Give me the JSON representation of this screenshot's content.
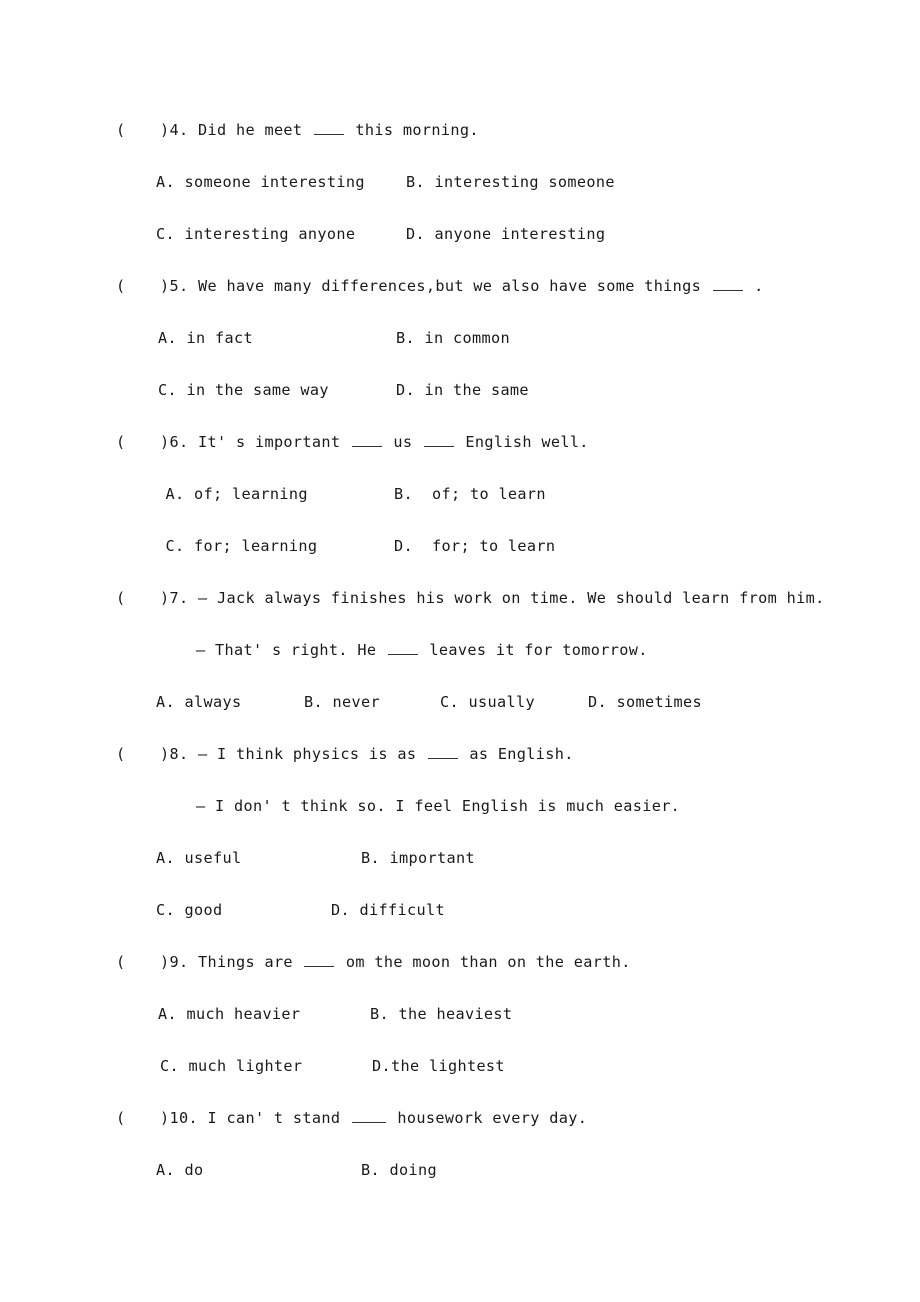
{
  "document": {
    "type": "english-exam-worksheet",
    "page_background": "#ffffff",
    "text_color": "#1a1a1a"
  },
  "questions": [
    {
      "paren": "(",
      "close": ")",
      "number": "4.",
      "stem_before": " Did he meet ",
      "stem_after": " this morning.",
      "reply": null,
      "option_rows": [
        {
          "left_label": "A.",
          "left_text": " someone interesting",
          "right_label": "B.",
          "right_text": " interesting someone"
        },
        {
          "left_label": "C.",
          "left_text": " interesting anyone",
          "right_label": "D.",
          "right_text": " anyone interesting"
        }
      ]
    },
    {
      "paren": "(",
      "close": ")",
      "number": "5.",
      "stem_before": " We have many differences,but we also have some things ",
      "stem_after": " .",
      "reply": null,
      "option_rows": [
        {
          "left_label": "A.",
          "left_text": " in fact",
          "right_label": "B.",
          "right_text": " in common"
        },
        {
          "left_label": "C.",
          "left_text": " in the same way",
          "right_label": "D.",
          "right_text": " in the same"
        }
      ]
    },
    {
      "paren": "(",
      "close": ")",
      "number": "6.",
      "stem_before": " It' s important ",
      "stem_middle": " us ",
      "stem_after": " English well.",
      "reply": null,
      "option_rows": [
        {
          "left_label": " A.",
          "left_text": " of; learning",
          "right_label": "B.",
          "right_text": "  of; to learn"
        },
        {
          "left_label": " C.",
          "left_text": " for; learning",
          "right_label": "D.",
          "right_text": "  for; to learn"
        }
      ]
    },
    {
      "paren": "(",
      "close": ")",
      "number": "7.",
      "stem_before": " — Jack always finishes his work on time. We should learn from him.",
      "stem_after": "",
      "reply_before": "— That' s right. He ",
      "reply_after": " leaves it for tomorrow.",
      "option_rows": [
        {
          "four": true,
          "a_label": "A.",
          "a_text": " always",
          "b_label": "B.",
          "b_text": " never",
          "c_label": "C.",
          "c_text": " usually",
          "d_label": "D.",
          "d_text": " sometimes"
        }
      ]
    },
    {
      "paren": "(",
      "close": ")",
      "number": "8.",
      "stem_before": " — I think physics is as ",
      "stem_after": " as English.",
      "reply_before": "— I don' t think so. I feel English is much easier.",
      "reply_after": "",
      "option_rows": [
        {
          "left_label": "A.",
          "left_text": " useful",
          "right_label": "B.",
          "right_text": " important"
        },
        {
          "left_label": "C.",
          "left_text": " good",
          "right_label": "D.",
          "right_text": " difficult"
        }
      ]
    },
    {
      "paren": "(",
      "close": ")",
      "number": "9.",
      "stem_before": " Things are ",
      "stem_after": " om the moon than on the earth.",
      "reply": null,
      "option_rows": [
        {
          "left_label": "A.",
          "left_text": " much heavier",
          "right_label": "B.",
          "right_text": " the heaviest"
        },
        {
          "left_label": "C.",
          "left_text": " much lighter",
          "right_label": "D.",
          "right_text": "the lightest"
        }
      ]
    },
    {
      "paren": "(",
      "close": ")",
      "number": "10.",
      "stem_before": " I can' t stand ",
      "stem_after": " housework every day.",
      "reply": null,
      "option_rows": [
        {
          "left_label": "A.",
          "left_text": " do",
          "right_label": "B.",
          "right_text": " doing"
        }
      ]
    }
  ]
}
